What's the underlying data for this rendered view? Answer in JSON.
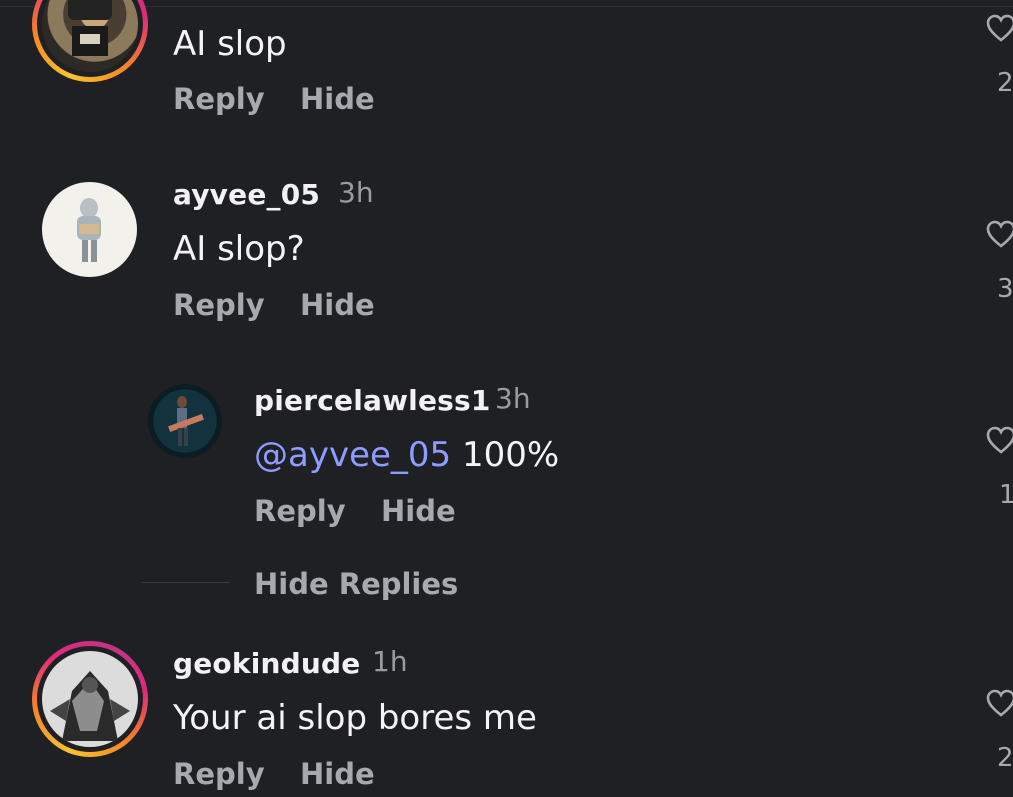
{
  "comments": [
    {
      "username": "",
      "time": "",
      "text": "AI slop",
      "reply_label": "Reply",
      "hide_label": "Hide",
      "likes": "2"
    },
    {
      "username": "ayvee_05",
      "time": "3h",
      "text": "AI slop?",
      "reply_label": "Reply",
      "hide_label": "Hide",
      "likes": "3"
    },
    {
      "username": "piercelawless1",
      "time": "3h",
      "mention": "@ayvee_05",
      "text": " 100%",
      "reply_label": "Reply",
      "hide_label": "Hide",
      "likes": "1"
    },
    {
      "username": "geokindude",
      "time": "1h",
      "text": "Your ai slop bores me",
      "reply_label": "Reply",
      "hide_label": "Hide",
      "likes": "2"
    }
  ],
  "hide_replies_label": "Hide Replies",
  "colors": {
    "background": "#1f2024",
    "mention": "#8f9cff",
    "story_ring": "#dd2a7b"
  },
  "icons": [
    "heart-icon"
  ]
}
